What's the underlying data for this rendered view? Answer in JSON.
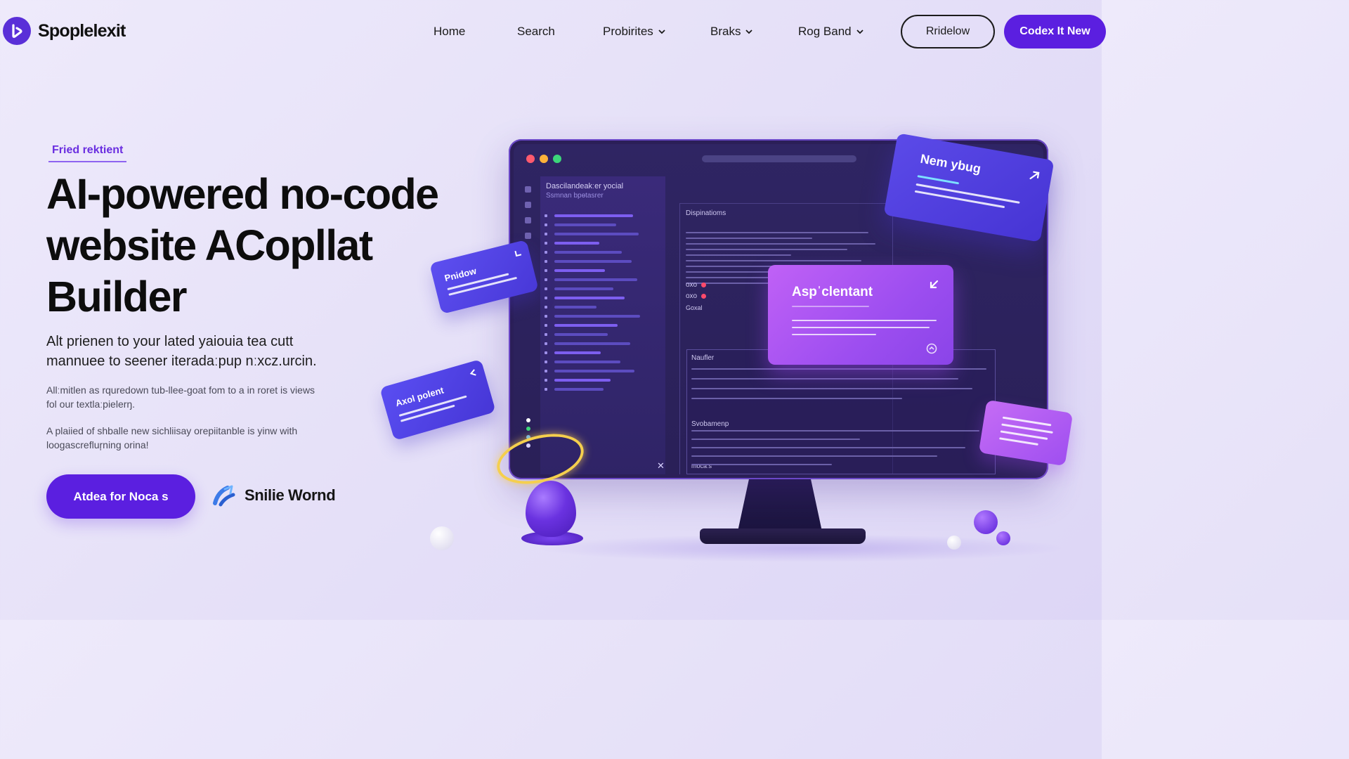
{
  "brand": {
    "name": "Spoplelexit",
    "accent": "#5b1fe0"
  },
  "nav": {
    "links": [
      {
        "label": "Home"
      },
      {
        "label": "Search"
      },
      {
        "label": "Probirites"
      },
      {
        "label": "Braks"
      },
      {
        "label": "Rog Band"
      }
    ],
    "outline_button": "Rridelow",
    "primary_button": "Codex It New"
  },
  "hero": {
    "eyebrow": "Fried rektient",
    "headline": [
      "AI-powered no-code",
      "website ACopllat",
      "Builder"
    ],
    "lead": [
      "Alt prienen to your lated yaiouia tea cutt",
      "mannuee to seener iteradaːpup nːxcz.urcin."
    ],
    "para1": [
      "Allːmitlen as rquredown tub-llee-goat fom to a in roret is views",
      "fol our textlaːpielerŋ."
    ],
    "para2": [
      "A plaiied of shballe new sichliisay orepiitanble is yinw with",
      "loogascrefluŗning orina!"
    ],
    "cta_primary": "Atdea for Noca s",
    "cta_secondary": "Snilie Wornd"
  },
  "monitor": {
    "file_panel_title": "Dascilandeakːer yocial",
    "file_panel_sub": "Ssmnan bpɵtasrer",
    "editor_title": "Dispinatioms",
    "editor_labels": [
      "oxo",
      "oxo",
      "Goxal"
    ],
    "panel_title": "Naufler",
    "panel_sub": "Svobamenp",
    "panel_foot": "mocaːs",
    "center_card_title": "Aspˈclentant"
  },
  "floating_cards": {
    "top_right": "Nem ybug",
    "left_upper": "Pnidow",
    "left_lower": "Axol polent"
  },
  "icons": {
    "logo": "logo-mark-icon",
    "chevron": "chevron-down-icon",
    "swirl": "swirl-icon",
    "arrow": "arrow-icon",
    "cloud": "cloud-icon"
  }
}
